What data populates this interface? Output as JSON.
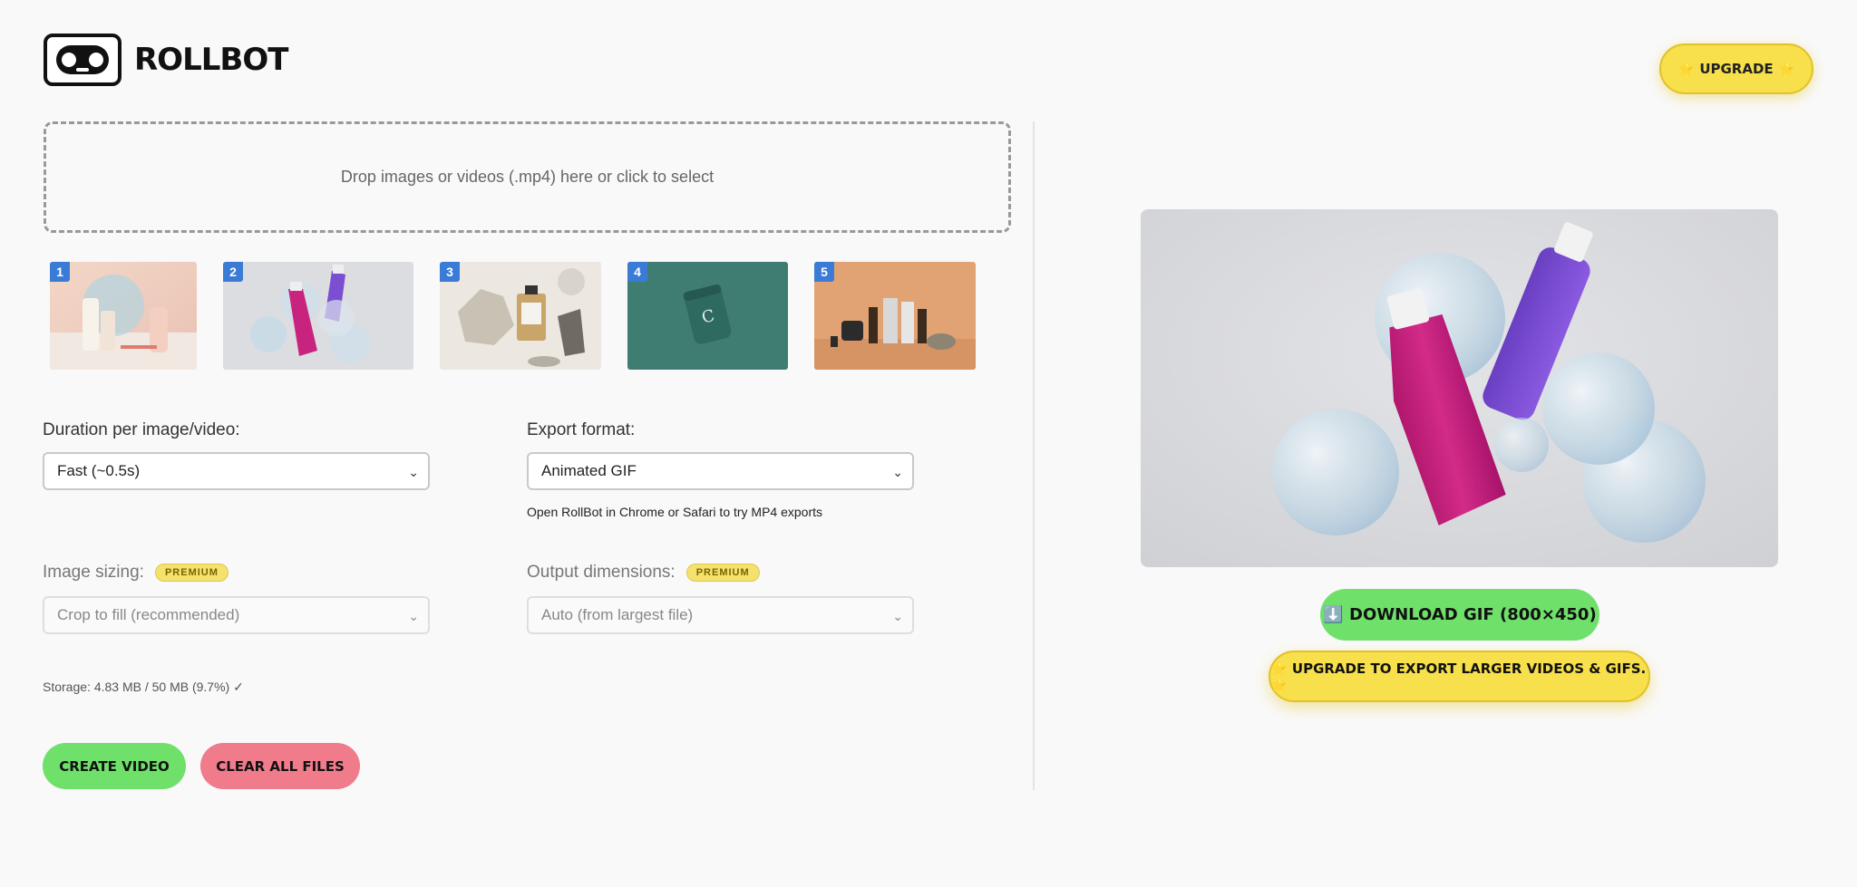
{
  "app": {
    "name": "ROLLBOT"
  },
  "header": {
    "upgrade_label": "⭐ UPGRADE ⭐"
  },
  "dropzone": {
    "text": "Drop images or videos (.mp4) here or click to select"
  },
  "thumbnails": [
    {
      "index": "1",
      "icon": "skincare-bottles-image"
    },
    {
      "index": "2",
      "icon": "pink-purple-bottles-bubbles-image"
    },
    {
      "index": "3",
      "icon": "perfume-on-stone-image"
    },
    {
      "index": "4",
      "icon": "green-jar-image"
    },
    {
      "index": "5",
      "icon": "serum-bottles-orange-image"
    }
  ],
  "settings": {
    "duration": {
      "label": "Duration per image/video:",
      "value": "Fast (~0.5s)"
    },
    "export_format": {
      "label": "Export format:",
      "value": "Animated GIF",
      "hint": "Open RollBot in Chrome or Safari to try MP4 exports"
    },
    "image_sizing": {
      "label": "Image sizing:",
      "badge": "PREMIUM",
      "value": "Crop to fill (recommended)"
    },
    "output_dimensions": {
      "label": "Output dimensions:",
      "badge": "PREMIUM",
      "value": "Auto (from largest file)"
    }
  },
  "storage": {
    "text": "Storage: 4.83 MB / 50 MB (9.7%) ✓"
  },
  "actions": {
    "create_label": "CREATE VIDEO",
    "clear_label": "CLEAR ALL FILES"
  },
  "preview": {
    "download_label": "⬇️ DOWNLOAD GIF (800×450)",
    "upgrade_label": "⭐ UPGRADE TO EXPORT LARGER VIDEOS & GIFS. ⭐"
  },
  "colors": {
    "green": "#6fe06a",
    "pink": "#ef7b8b",
    "yellow": "#f7e04b",
    "badge_blue": "#3a7bd5"
  }
}
